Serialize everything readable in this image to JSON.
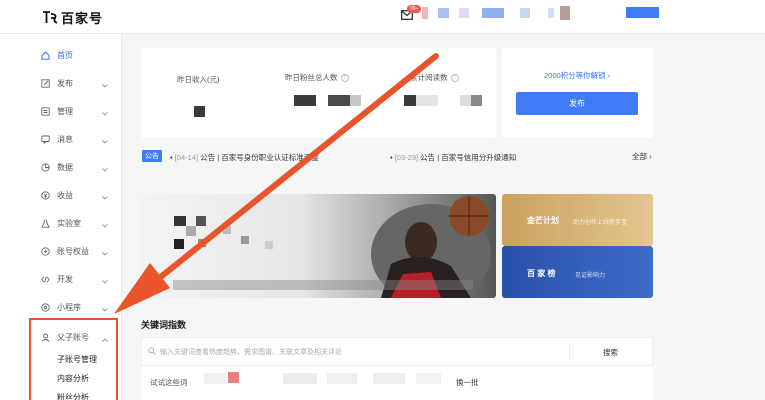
{
  "header": {
    "logo_text": "百家号",
    "mail_badge": "99+"
  },
  "sidebar": {
    "items": [
      {
        "label": "首页",
        "icon": "home-icon"
      },
      {
        "label": "发布",
        "icon": "publish-icon"
      },
      {
        "label": "管理",
        "icon": "manage-icon"
      },
      {
        "label": "消息",
        "icon": "message-icon"
      },
      {
        "label": "数据",
        "icon": "data-icon"
      },
      {
        "label": "收益",
        "icon": "income-icon"
      },
      {
        "label": "实验室",
        "icon": "lab-icon"
      },
      {
        "label": "账号权益",
        "icon": "rights-icon"
      },
      {
        "label": "开发",
        "icon": "code-icon"
      },
      {
        "label": "小程序",
        "icon": "miniapp-icon"
      },
      {
        "label": "父子账号",
        "icon": "user-icon"
      }
    ],
    "sub_items": [
      "子账号管理",
      "内容分析",
      "粉丝分析"
    ]
  },
  "stats": {
    "yesterday_income": "昨日收入(元)",
    "yesterday_fans": "昨日粉丝总人数",
    "total_reads": "累计阅读数"
  },
  "publish_card": {
    "unlock_text": "2000积分等你解锁",
    "publish_label": "发布"
  },
  "notices": {
    "tag": "公告",
    "n1_date": "[04-14]",
    "n1_text": "公告 | 百家号身份职业认证标准调整",
    "n2_date": "[03-29]",
    "n2_text": "公告 | 百家号信用分升级通知",
    "all": "全部"
  },
  "banners": {
    "top_title": "金芒计划",
    "top_sub": "助力创作上线新手宝",
    "bottom_title": "百 家 榜",
    "bottom_sub": "见证影响力"
  },
  "keywords": {
    "title": "关键词指数",
    "placeholder": "输入关键词查看热度趋势、需求图谱、关联文章及相关评论",
    "search_label": "搜索",
    "try_label": "试试这些词",
    "refresh_label": "换一批"
  },
  "colors": {
    "accent": "#3f7bf5",
    "arrow": "#e9542c"
  }
}
